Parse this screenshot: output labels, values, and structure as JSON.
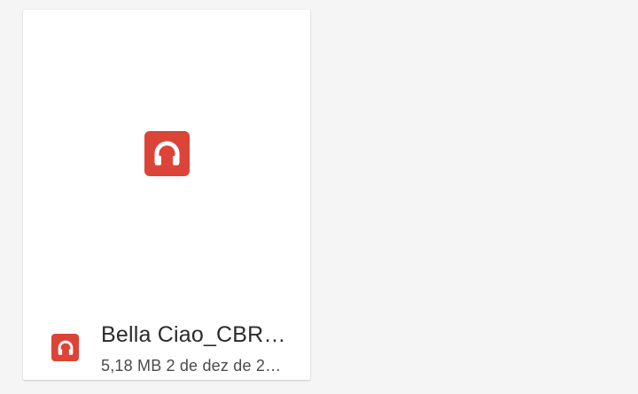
{
  "file_card": {
    "name": "Bella Ciao_CBR…",
    "size": "5,18 MB",
    "date": "2 de dez de 2…",
    "icon": "headphones-icon",
    "icon_color": "#db4437"
  },
  "colors": {
    "background": "#f5f5f5",
    "card": "#ffffff",
    "accent": "#db4437"
  }
}
